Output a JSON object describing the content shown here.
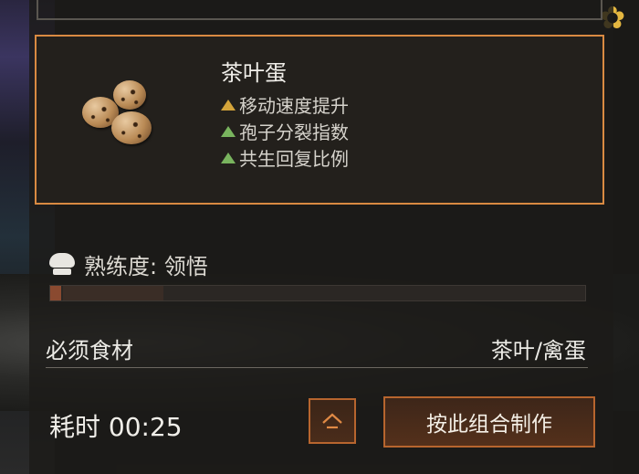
{
  "card": {
    "dish_name": "茶叶蛋",
    "dish_icon": "tea-eggs-image",
    "effects": [
      {
        "label": "移动速度提升",
        "arrow": "up",
        "color": "#d4a43a"
      },
      {
        "label": "孢子分裂指数",
        "arrow": "up",
        "color": "#79b45e"
      },
      {
        "label": "共生回复比例",
        "arrow": "up",
        "color": "#79b45e"
      }
    ]
  },
  "proficiency": {
    "icon": "chef-hat-icon",
    "text": "熟练度: 领悟",
    "progress_fraction": 0.02
  },
  "ingredients": {
    "label": "必须食材",
    "value": "茶叶/禽蛋"
  },
  "footer": {
    "time_text": "耗时 00:25",
    "collapse_icon": "collapse-up-icon",
    "make_label": "按此组合制作"
  },
  "colors": {
    "card_border": "#d98a42",
    "button_border": "#b7652e",
    "progress_fill": "#8a4a30"
  }
}
